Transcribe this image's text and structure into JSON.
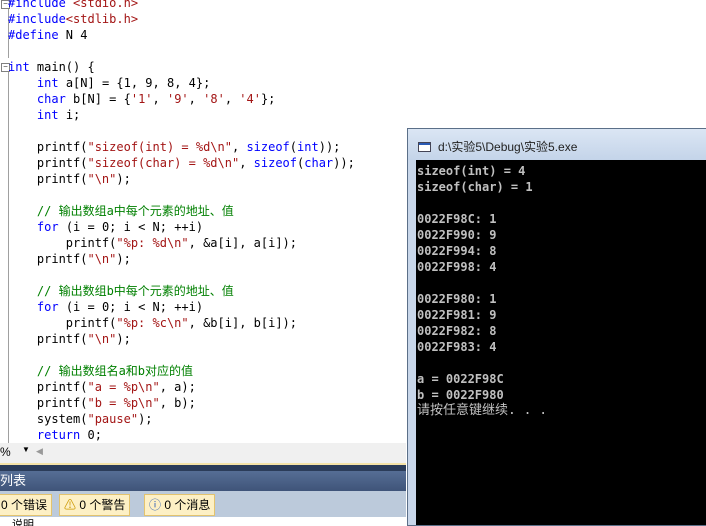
{
  "editor": {
    "lines": [
      [
        [
          "pp",
          "#include "
        ],
        [
          "str",
          "<stdio.h>"
        ]
      ],
      [
        [
          "pp",
          "#include"
        ],
        [
          "str",
          "<stdlib.h>"
        ]
      ],
      [
        [
          "pp",
          "#define"
        ],
        [
          "t",
          " N 4"
        ]
      ],
      [],
      [
        [
          "kw",
          "int"
        ],
        [
          "t",
          " main() {"
        ]
      ],
      [
        [
          "t",
          "    "
        ],
        [
          "kw",
          "int"
        ],
        [
          "t",
          " a[N] = {1, 9, 8, 4};"
        ]
      ],
      [
        [
          "t",
          "    "
        ],
        [
          "kw",
          "char"
        ],
        [
          "t",
          " b[N] = {"
        ],
        [
          "str",
          "'1'"
        ],
        [
          "t",
          ", "
        ],
        [
          "str",
          "'9'"
        ],
        [
          "t",
          ", "
        ],
        [
          "str",
          "'8'"
        ],
        [
          "t",
          ", "
        ],
        [
          "str",
          "'4'"
        ],
        [
          "t",
          "};"
        ]
      ],
      [
        [
          "t",
          "    "
        ],
        [
          "kw",
          "int"
        ],
        [
          "t",
          " i;"
        ]
      ],
      [],
      [
        [
          "t",
          "    printf("
        ],
        [
          "str",
          "\"sizeof(int) = %d\\n\""
        ],
        [
          "t",
          ", "
        ],
        [
          "kw",
          "sizeof"
        ],
        [
          "t",
          "("
        ],
        [
          "kw",
          "int"
        ],
        [
          "t",
          "));"
        ]
      ],
      [
        [
          "t",
          "    printf("
        ],
        [
          "str",
          "\"sizeof(char) = %d\\n\""
        ],
        [
          "t",
          ", "
        ],
        [
          "kw",
          "sizeof"
        ],
        [
          "t",
          "("
        ],
        [
          "kw",
          "char"
        ],
        [
          "t",
          "));"
        ]
      ],
      [
        [
          "t",
          "    printf("
        ],
        [
          "str",
          "\"\\n\""
        ],
        [
          "t",
          ");"
        ]
      ],
      [],
      [
        [
          "t",
          "    "
        ],
        [
          "cm",
          "// 输出数组a中每个元素的地址、值"
        ]
      ],
      [
        [
          "t",
          "    "
        ],
        [
          "kw",
          "for"
        ],
        [
          "t",
          " (i = 0; i < N; ++i)"
        ]
      ],
      [
        [
          "t",
          "        printf("
        ],
        [
          "str",
          "\"%p: %d\\n\""
        ],
        [
          "t",
          ", &a[i], a[i]);"
        ]
      ],
      [
        [
          "t",
          "    printf("
        ],
        [
          "str",
          "\"\\n\""
        ],
        [
          "t",
          ");"
        ]
      ],
      [],
      [
        [
          "t",
          "    "
        ],
        [
          "cm",
          "// 输出数组b中每个元素的地址、值"
        ]
      ],
      [
        [
          "t",
          "    "
        ],
        [
          "kw",
          "for"
        ],
        [
          "t",
          " (i = 0; i < N; ++i)"
        ]
      ],
      [
        [
          "t",
          "        printf("
        ],
        [
          "str",
          "\"%p: %c\\n\""
        ],
        [
          "t",
          ", &b[i], b[i]);"
        ]
      ],
      [
        [
          "t",
          "    printf("
        ],
        [
          "str",
          "\"\\n\""
        ],
        [
          "t",
          ");"
        ]
      ],
      [],
      [
        [
          "t",
          "    "
        ],
        [
          "cm",
          "// 输出数组名a和b对应的值"
        ]
      ],
      [
        [
          "t",
          "    printf("
        ],
        [
          "str",
          "\"a = %p\\n\""
        ],
        [
          "t",
          ", a);"
        ]
      ],
      [
        [
          "t",
          "    printf("
        ],
        [
          "str",
          "\"b = %p\\n\""
        ],
        [
          "t",
          ", b);"
        ]
      ],
      [
        [
          "t",
          "    system("
        ],
        [
          "str",
          "\"pause\""
        ],
        [
          "t",
          ");"
        ]
      ],
      [
        [
          "t",
          "    "
        ],
        [
          "kw",
          "return"
        ],
        [
          "t",
          " 0;"
        ]
      ]
    ],
    "zoom_value": "%"
  },
  "error_list": {
    "title": "列表",
    "errors": "0 个错误",
    "warnings": "0 个警告",
    "messages": "0 个消息",
    "column_description": "说明"
  },
  "console": {
    "title": "d:\\实验5\\Debug\\实验5.exe",
    "lines": [
      "sizeof(int) = 4",
      "sizeof(char) = 1",
      "",
      "0022F98C: 1",
      "0022F990: 9",
      "0022F994: 8",
      "0022F998: 4",
      "",
      "0022F980: 1",
      "0022F981: 9",
      "0022F982: 8",
      "0022F983: 4",
      "",
      "a = 0022F98C",
      "b = 0022F980",
      "请按任意键继续. . ."
    ]
  }
}
